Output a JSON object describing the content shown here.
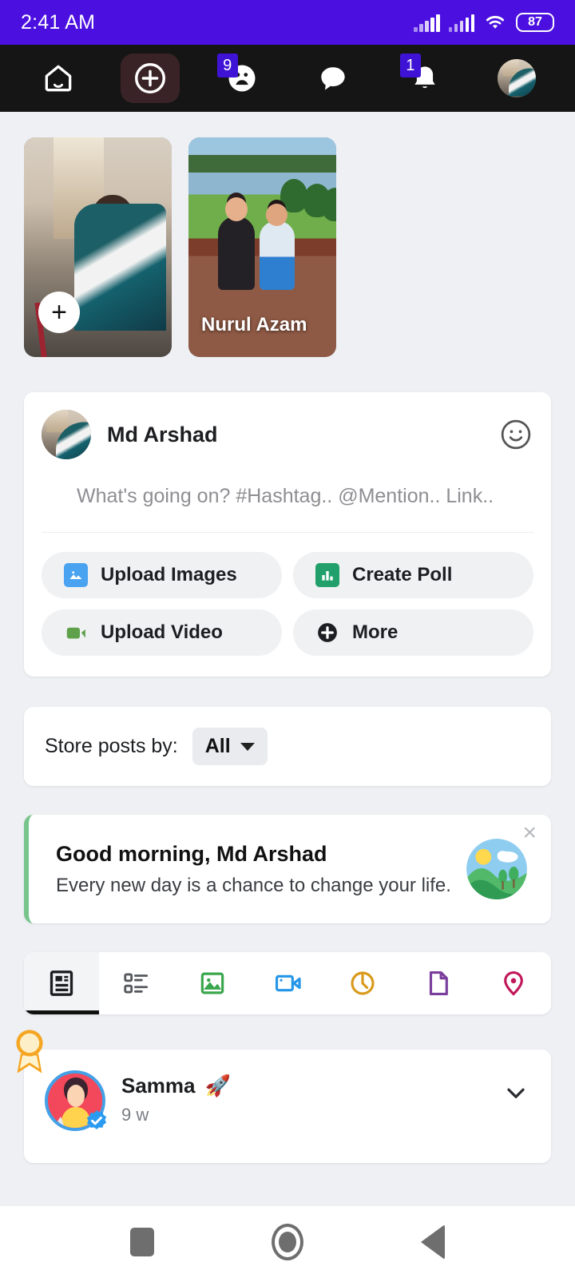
{
  "status_bar": {
    "time": "2:41 AM",
    "battery": "87",
    "signal_icon": "signal-bars-icon",
    "wifi_icon": "wifi-icon",
    "accent_color": "#4b10e0"
  },
  "top_nav": {
    "items": [
      {
        "name": "home",
        "icon": "home-icon",
        "badge": ""
      },
      {
        "name": "create",
        "icon": "plus-circle-icon",
        "badge": "",
        "active": true
      },
      {
        "name": "friends",
        "icon": "friends-icon",
        "badge": "9"
      },
      {
        "name": "messages",
        "icon": "chat-bubble-icon",
        "badge": ""
      },
      {
        "name": "notifications",
        "icon": "bell-icon",
        "badge": "1"
      },
      {
        "name": "profile",
        "icon": "avatar-icon",
        "badge": ""
      }
    ],
    "background": "#151515",
    "badge_color": "#3f13d6"
  },
  "stories": [
    {
      "name": "add-story",
      "label": "",
      "add_label": "+"
    },
    {
      "name": "story-nurul",
      "label": "Nurul Azam"
    }
  ],
  "composer": {
    "user_name": "Md Arshad",
    "emoji_icon": "smiley-icon",
    "placeholder": "What's going on? #Hashtag.. @Mention.. Link..",
    "actions": [
      {
        "label": "Upload Images",
        "icon": "image-icon",
        "color": "#4aa3f0"
      },
      {
        "label": "Create Poll",
        "icon": "poll-bar-chart-icon",
        "color": "#22a06b"
      },
      {
        "label": "Upload Video",
        "icon": "video-camera-icon",
        "color": "#5fa14a"
      },
      {
        "label": "More",
        "icon": "plus-circle-filled-icon",
        "color": "#1c1e21"
      }
    ]
  },
  "filter": {
    "label": "Store posts by:",
    "value": "All",
    "caret_icon": "caret-down-icon"
  },
  "greeting": {
    "title": "Good morning, Md Arshad",
    "subtitle": "Every new day is a chance to change your life.",
    "close_label": "×",
    "accent_color": "#77c58c",
    "illustration": "landscape-circle-icon"
  },
  "type_tabs": [
    {
      "name": "tab-article",
      "icon": "article-icon",
      "color": "#1c1e21",
      "active": true
    },
    {
      "name": "tab-list",
      "icon": "list-icon",
      "color": "#55585d",
      "active": false
    },
    {
      "name": "tab-image",
      "icon": "image-outline-icon",
      "color": "#3aa64c",
      "active": false
    },
    {
      "name": "tab-video",
      "icon": "video-outline-icon",
      "color": "#2596e8",
      "active": false
    },
    {
      "name": "tab-audio",
      "icon": "audio-dial-icon",
      "color": "#d99a1c",
      "active": false
    },
    {
      "name": "tab-document",
      "icon": "document-icon",
      "color": "#7a3e9d",
      "active": false
    },
    {
      "name": "tab-location",
      "icon": "location-pin-icon",
      "color": "#c2185b",
      "active": false
    }
  ],
  "post": {
    "author": "Samma",
    "author_emoji": "🚀",
    "time": "9 w",
    "award_icon": "award-ribbon-icon",
    "verified_icon": "verified-badge-icon",
    "menu_icon": "chevron-down-icon"
  },
  "android_nav": [
    {
      "name": "recents-button",
      "icon": "square-icon"
    },
    {
      "name": "home-button",
      "icon": "circle-icon"
    },
    {
      "name": "back-button",
      "icon": "triangle-left-icon"
    }
  ]
}
